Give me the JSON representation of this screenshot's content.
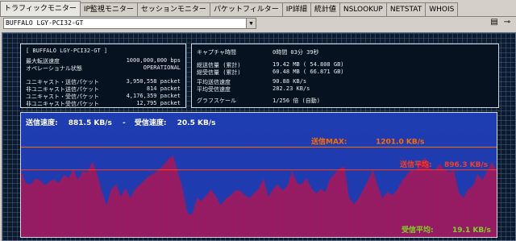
{
  "tabs": [
    {
      "label": "トラフィックモニター",
      "active": true
    },
    {
      "label": "IP監視モニター",
      "active": false
    },
    {
      "label": "セッションモニター",
      "active": false
    },
    {
      "label": "パケットフィルター",
      "active": false
    },
    {
      "label": "IP詳細",
      "active": false
    },
    {
      "label": "統計値",
      "active": false
    },
    {
      "label": "NSLOOKUP",
      "active": false
    },
    {
      "label": "NETSTAT",
      "active": false
    },
    {
      "label": "WHOIS",
      "active": false
    }
  ],
  "adapter_select": {
    "value": "BUFFALO LGY-PCI32-GT"
  },
  "toolbar_icons": [
    "window-list-icon",
    "pin-icon"
  ],
  "adapter_box": {
    "title": "[ BUFFALO LGY-PCI32-GT ]",
    "rows": [
      {
        "label": "最大転送速度",
        "value": "1000,000,000 bps"
      },
      {
        "label": "オペレーショナル状態",
        "value": "OPERATIONAL"
      },
      {
        "label": "ユニキャスト・送信パケット",
        "value": "3,950,558 packet"
      },
      {
        "label": "非ユニキャスト送信パケット",
        "value": "814 packet"
      },
      {
        "label": "ユニキャスト・受信パケット",
        "value": "4,176,359 packet"
      },
      {
        "label": "非ユニキャスト受信パケット",
        "value": "12,795 packet"
      }
    ]
  },
  "capture_box": {
    "rows": [
      {
        "label": "キャプチャ時間",
        "value": "0時間 03分 39秒"
      },
      {
        "label": "総送信量 (累計)",
        "value": "19.42 MB ( 54.808 GB)"
      },
      {
        "label": "総受信量 (累計)",
        "value": "60.48 MB ( 66.871 GB)"
      },
      {
        "label": "平均送信速度",
        "value": "90.88 KB/s"
      },
      {
        "label": "平均受信速度",
        "value": "282.23 KB/s"
      },
      {
        "label": "グラフスケール",
        "value": "1/256 倍 (自動)"
      }
    ]
  },
  "chart_header": {
    "send_label": "送信速度:",
    "send_value": "881.5 KB/s",
    "separator": "-",
    "recv_label": "受信速度:",
    "recv_value": "20.5 KB/s"
  },
  "chart_data": {
    "type": "area",
    "annotations": [
      {
        "label": "送信MAX:",
        "value": "1201.0 KB/s"
      },
      {
        "label": "送信平均:",
        "value": "896.3 KB/s"
      },
      {
        "label": "受信平均:",
        "value": "19.1 KB/s"
      }
    ],
    "send_max": 1201.0,
    "send_avg": 896.3,
    "values": [
      880,
      720,
      700,
      780,
      760,
      690,
      740,
      770,
      720,
      830,
      790,
      900,
      760,
      880,
      860,
      1010,
      850,
      600,
      420,
      640,
      700,
      540,
      650,
      520,
      640,
      700,
      760,
      820,
      850,
      900,
      960,
      1040,
      1090,
      860,
      640,
      320,
      300,
      520,
      480,
      560,
      630,
      540,
      420,
      510,
      550,
      620,
      620,
      560,
      520,
      580,
      650,
      780,
      540,
      640,
      700,
      620,
      680,
      880,
      720,
      700,
      790,
      660,
      580,
      640,
      600,
      780,
      850,
      920,
      940,
      520,
      440,
      520,
      640,
      760,
      900,
      680,
      520,
      600,
      560,
      620,
      740,
      820,
      900,
      880,
      1000,
      1060,
      920,
      880,
      980,
      900,
      860,
      900,
      600,
      520,
      640,
      680,
      840,
      760,
      880,
      1000,
      880
    ]
  },
  "colors": {
    "send_fill": "#a0195c",
    "chart_bg": "#1d3db0",
    "max_line": "#ff6a00",
    "avg_line": "#ff3b1e",
    "recv_text": "#7cd622"
  }
}
